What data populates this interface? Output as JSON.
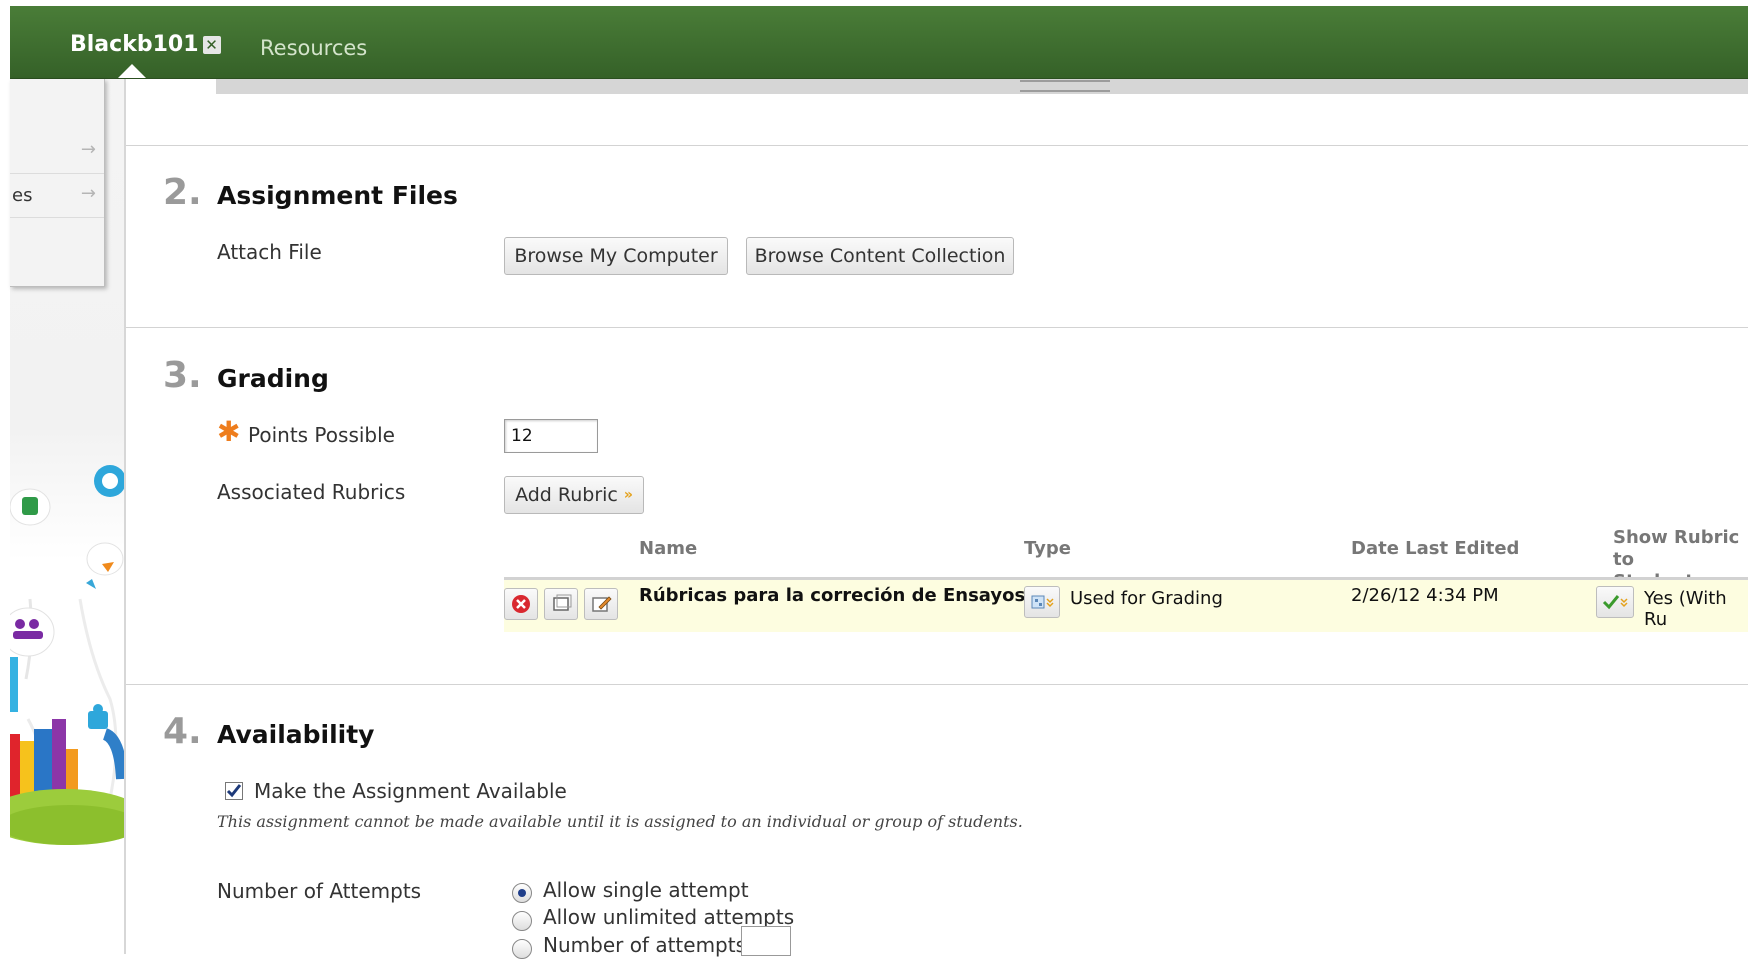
{
  "nav": {
    "course_tab": "Blackb101",
    "course_close_glyph": "✕",
    "resources_tab": "Resources",
    "background_color": "#3f6f30"
  },
  "side_menu": {
    "items": [
      {
        "label": "",
        "arrow": "→"
      },
      {
        "label": "es",
        "arrow": "→"
      }
    ]
  },
  "sections": {
    "files": {
      "number": "2.",
      "title": "Assignment Files",
      "attach_label": "Attach File",
      "browse_computer": "Browse My Computer",
      "browse_collection": "Browse Content Collection"
    },
    "grading": {
      "number": "3.",
      "title": "Grading",
      "required_marker": "✱",
      "points_label": "Points Possible",
      "points_value": "12",
      "rubrics_label": "Associated Rubrics",
      "add_rubric": "Add Rubric",
      "add_rubric_chevron": "»",
      "table": {
        "headers": {
          "name": "Name",
          "type": "Type",
          "date": "Date Last Edited",
          "show_line1": "Show Rubric to",
          "show_line2": "Students"
        },
        "row": {
          "name": "Rúbricas para la correción de Ensayos",
          "type": "Used for Grading",
          "date": "2/26/12 4:34 PM",
          "show": "Yes (With Ru"
        }
      }
    },
    "availability": {
      "number": "4.",
      "title": "Availability",
      "make_available": "Make the Assignment Available",
      "make_available_checked": true,
      "note": "This assignment cannot be made available until it is assigned to an individual or group of students.",
      "attempts_label": "Number of Attempts",
      "options": {
        "single": "Allow single attempt",
        "unlimited": "Allow unlimited attempts",
        "number": "Number of attempts:"
      },
      "selected_option": "single"
    }
  },
  "colors": {
    "accent_orange": "#ee7d1d",
    "row_highlight": "#fdfde0",
    "section_number": "#9a9a9a"
  }
}
